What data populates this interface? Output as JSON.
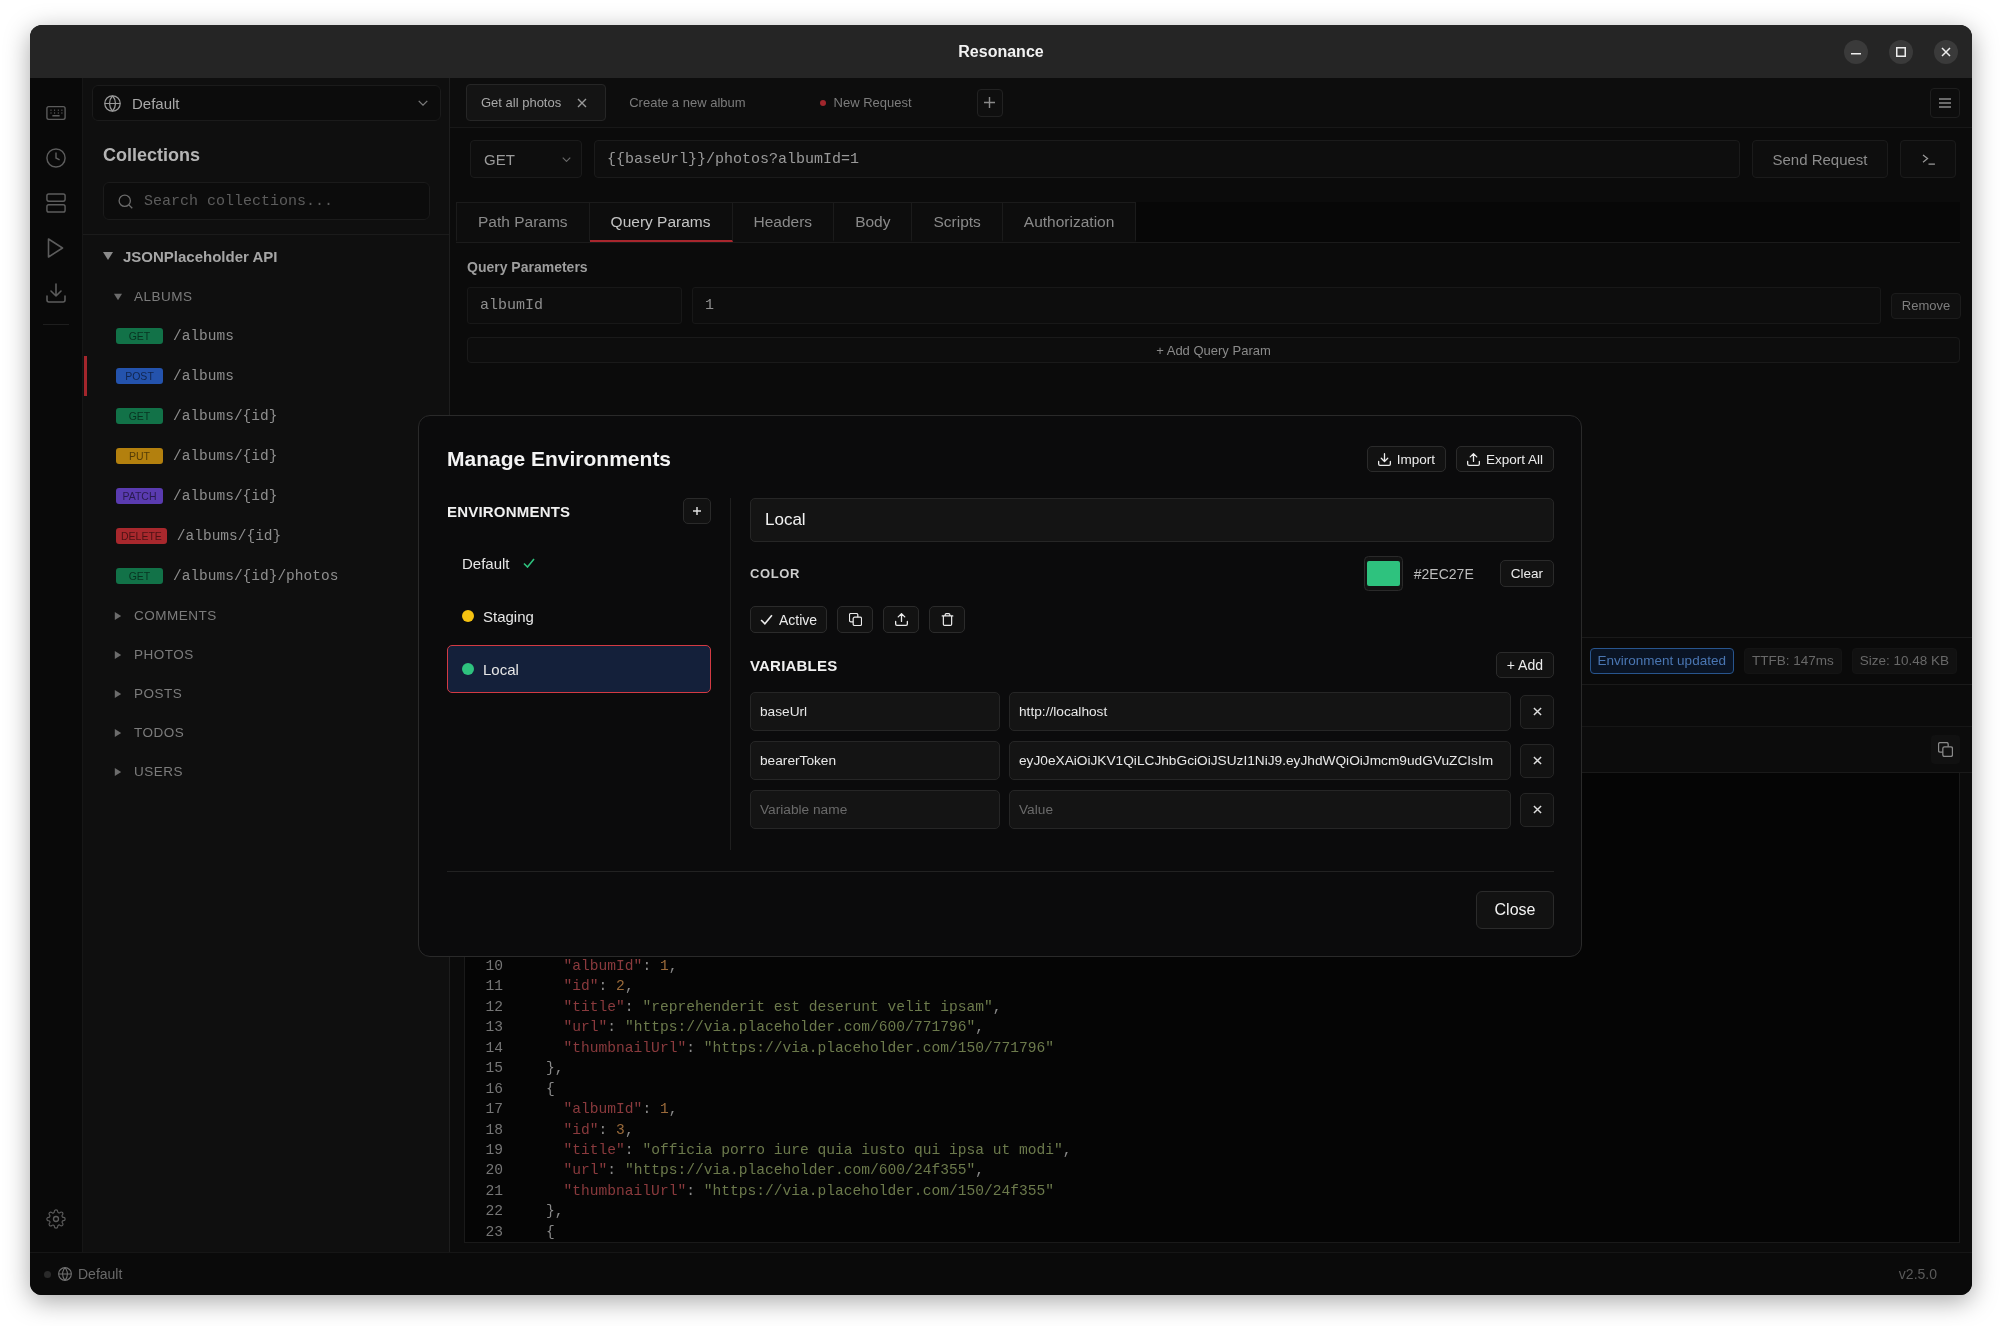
{
  "window": {
    "title": "Resonance"
  },
  "sidebar": {
    "environment": {
      "value": "Default"
    },
    "title": "Collections",
    "search": {
      "placeholder": "Search collections..."
    },
    "tree": [
      {
        "label": "JSONPlaceholder API",
        "expanded": true,
        "children": [
          {
            "label": "ALBUMS",
            "expanded": true,
            "children": [
              {
                "method": "GET",
                "path": "/albums",
                "color": "#127248",
                "selected": false
              },
              {
                "method": "POST",
                "path": "/albums",
                "color": "#2453ad",
                "selected": true
              },
              {
                "method": "GET",
                "path": "/albums/{id}",
                "color": "#127248",
                "selected": false
              },
              {
                "method": "PUT",
                "path": "/albums/{id}",
                "color": "#b3800e",
                "selected": false
              },
              {
                "method": "PATCH",
                "path": "/albums/{id}",
                "color": "#5a3bb0",
                "selected": false
              },
              {
                "method": "DELETE",
                "path": "/albums/{id}",
                "color": "#a8282d",
                "selected": false
              },
              {
                "method": "GET",
                "path": "/albums/{id}/photos",
                "color": "#127248",
                "selected": false
              }
            ]
          },
          {
            "label": "COMMENTS",
            "expanded": false
          },
          {
            "label": "PHOTOS",
            "expanded": false
          },
          {
            "label": "POSTS",
            "expanded": false
          },
          {
            "label": "TODOS",
            "expanded": false
          },
          {
            "label": "USERS",
            "expanded": false
          }
        ]
      }
    ]
  },
  "request_tabs": [
    {
      "label": "Get all photos",
      "selected": true,
      "closable": true,
      "unsaved": false
    },
    {
      "label": "Create a new album",
      "selected": false,
      "closable": false,
      "unsaved": false
    },
    {
      "label": "New Request",
      "selected": false,
      "closable": false,
      "unsaved": true
    }
  ],
  "request": {
    "method": "GET",
    "url": "{{baseUrl}}/photos?albumId=1",
    "send_label": "Send Request"
  },
  "param_tabs": [
    {
      "label": "Path Params",
      "selected": false
    },
    {
      "label": "Query Params",
      "selected": true
    },
    {
      "label": "Headers",
      "selected": false
    },
    {
      "label": "Body",
      "selected": false
    },
    {
      "label": "Scripts",
      "selected": false
    },
    {
      "label": "Authorization",
      "selected": false
    }
  ],
  "query_params": {
    "title": "Query Parameters",
    "rows": [
      {
        "key": "albumId",
        "value": "1",
        "remove_label": "Remove"
      }
    ],
    "add_label": "+ Add Query Param"
  },
  "response": {
    "badges": [
      {
        "label": "Environment updated",
        "kind": "notice"
      },
      {
        "label": "TTFB: 147ms",
        "kind": "metric"
      },
      {
        "label": "Size: 10.48 KB",
        "kind": "metric"
      }
    ],
    "code_lines": [
      {
        "number": "10",
        "text": "      \"albumId\": 1,"
      },
      {
        "number": "11",
        "text": "      \"id\": 2,"
      },
      {
        "number": "12",
        "text": "      \"title\": \"reprehenderit est deserunt velit ipsam\","
      },
      {
        "number": "13",
        "text": "      \"url\": \"https://via.placeholder.com/600/771796\","
      },
      {
        "number": "14",
        "text": "      \"thumbnailUrl\": \"https://via.placeholder.com/150/771796\""
      },
      {
        "number": "15",
        "text": "    },"
      },
      {
        "number": "16",
        "text": "    {"
      },
      {
        "number": "17",
        "text": "      \"albumId\": 1,"
      },
      {
        "number": "18",
        "text": "      \"id\": 3,"
      },
      {
        "number": "19",
        "text": "      \"title\": \"officia porro iure quia iusto qui ipsa ut modi\","
      },
      {
        "number": "20",
        "text": "      \"url\": \"https://via.placeholder.com/600/24f355\","
      },
      {
        "number": "21",
        "text": "      \"thumbnailUrl\": \"https://via.placeholder.com/150/24f355\""
      },
      {
        "number": "22",
        "text": "    },"
      },
      {
        "number": "23",
        "text": "    {"
      }
    ]
  },
  "status_bar": {
    "environment": "Default",
    "version": "v2.5.0"
  },
  "modal": {
    "title": "Manage Environments",
    "import_label": "Import",
    "export_label": "Export All",
    "environments_heading": "ENVIRONMENTS",
    "environments": [
      {
        "name": "Default",
        "active": true,
        "selected": false
      },
      {
        "name": "Staging",
        "color": "#f5c211",
        "active": false,
        "selected": false
      },
      {
        "name": "Local",
        "color": "#2ec27e",
        "active": false,
        "selected": true
      }
    ],
    "detail": {
      "name": "Local",
      "color_label": "COLOR",
      "color_hex": "#2EC27E",
      "clear_label": "Clear",
      "active_label": "Active",
      "variables_heading": "VARIABLES",
      "add_label": "+ Add",
      "variables": [
        {
          "name": "baseUrl",
          "value": "http://localhost"
        },
        {
          "name": "bearerToken",
          "value": "eyJ0eXAiOiJKV1QiLCJhbGciOiJSUzI1NiJ9.eyJhdWQiOiJmcm9udGVuZCIsIm"
        }
      ],
      "new_variable": {
        "name_field": {
          "placeholder": "Variable name"
        },
        "value_field": {
          "placeholder": "Value"
        }
      }
    },
    "close_label": "Close"
  }
}
